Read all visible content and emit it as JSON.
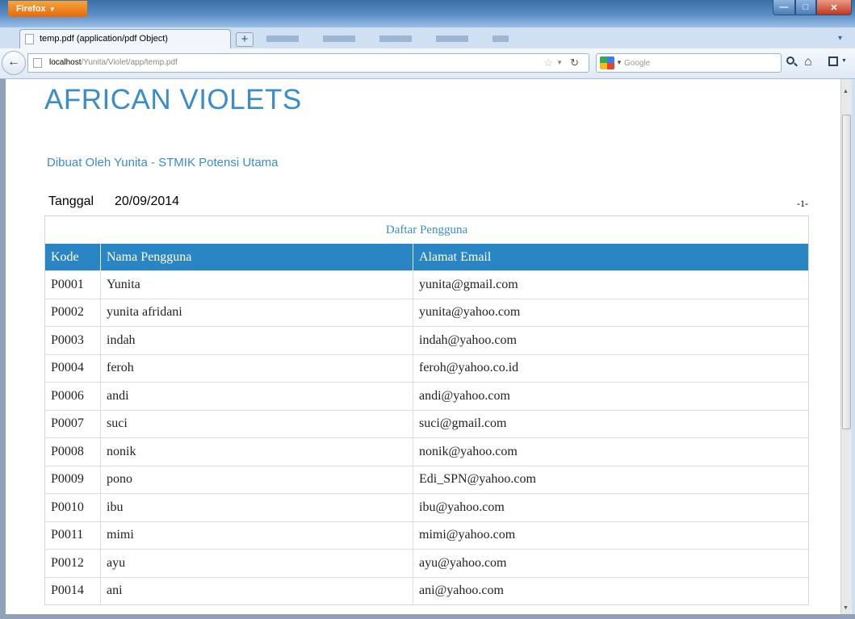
{
  "browser": {
    "menu_button": "Firefox",
    "tab_title": "temp.pdf (application/pdf Object)",
    "url_host": "localhost",
    "url_path": "/Yunita/Violet/app/temp.pdf",
    "search_placeholder": "Google"
  },
  "document": {
    "title": "AFRICAN VIOLETS",
    "subtitle": "Dibuat Oleh Yunita - STMIK Potensi Utama",
    "date_label": "Tanggal",
    "date_value": "20/09/2014",
    "page_number": "-1-",
    "table_caption": "Daftar Pengguna",
    "columns": [
      "Kode",
      "Nama Pengguna",
      "Alamat Email"
    ],
    "rows": [
      [
        "P0001",
        "Yunita",
        "yunita@gmail.com"
      ],
      [
        "P0002",
        "yunita afridani",
        "yunita@yahoo.com"
      ],
      [
        "P0003",
        "indah",
        "indah@yahoo.com"
      ],
      [
        "P0004",
        "feroh",
        "feroh@yahoo.co.id"
      ],
      [
        "P0006",
        "andi",
        "andi@yahoo.com"
      ],
      [
        "P0007",
        "suci",
        "suci@gmail.com"
      ],
      [
        "P0008",
        "nonik",
        "nonik@yahoo.com"
      ],
      [
        "P0009",
        "pono",
        "Edi_SPN@yahoo.com"
      ],
      [
        "P0010",
        "ibu",
        "ibu@yahoo.com"
      ],
      [
        "P0011",
        "mimi",
        "mimi@yahoo.com"
      ],
      [
        "P0012",
        "ayu",
        "ayu@yahoo.com"
      ],
      [
        "P0014",
        "ani",
        "ani@yahoo.com"
      ]
    ]
  },
  "colors": {
    "accent": "#3a8dc9",
    "table_header": "#2a85c4"
  }
}
